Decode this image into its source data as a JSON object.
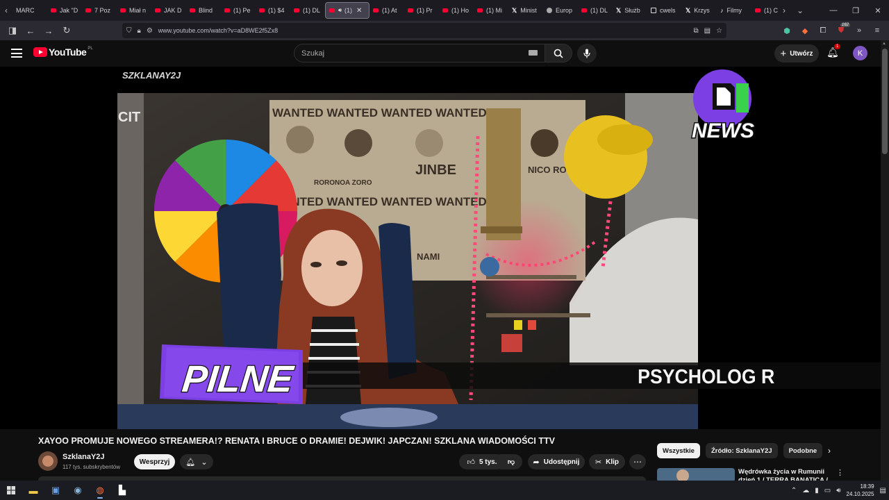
{
  "browser": {
    "tabs": [
      {
        "label": "MARC",
        "icon": "none"
      },
      {
        "label": "Jak \"D",
        "icon": "youtube"
      },
      {
        "label": "7 Poz",
        "icon": "youtube"
      },
      {
        "label": "Miał n",
        "icon": "youtube"
      },
      {
        "label": "JAK D",
        "icon": "youtube"
      },
      {
        "label": "Blind",
        "icon": "youtube"
      },
      {
        "label": "(1) Pe",
        "icon": "youtube"
      },
      {
        "label": "(1) $4",
        "icon": "youtube"
      },
      {
        "label": "(1) DL",
        "icon": "youtube"
      },
      {
        "label": "(1)",
        "icon": "youtube",
        "active": true,
        "audio": true
      },
      {
        "label": "(1) At",
        "icon": "youtube"
      },
      {
        "label": "(1) Pr",
        "icon": "youtube"
      },
      {
        "label": "(1) Ho",
        "icon": "youtube"
      },
      {
        "label": "(1) Mi",
        "icon": "youtube"
      },
      {
        "label": "Minist",
        "icon": "x"
      },
      {
        "label": "Europ",
        "icon": "globe"
      },
      {
        "label": "(1) DL",
        "icon": "youtube"
      },
      {
        "label": "Służb",
        "icon": "x"
      },
      {
        "label": "cwels",
        "icon": "doc"
      },
      {
        "label": "Krzys",
        "icon": "x"
      },
      {
        "label": "Filmy",
        "icon": "tiktok"
      },
      {
        "label": "(1) C",
        "icon": "youtube"
      }
    ],
    "url": "www.youtube.com/watch?v=aD8WE2f5Zx8",
    "extensions_badge": "162"
  },
  "youtube": {
    "logo_text": "YouTube",
    "region": "PL",
    "search_placeholder": "Szukaj",
    "create_label": "Utwórz",
    "notifications_count": "1",
    "avatar_letter": "K"
  },
  "video": {
    "watermark": "SZKLANAY2J",
    "banner": "PILNE",
    "ticker": "PSYCHOLOG R",
    "news_badge": "NEWS",
    "wanted_text": "WANTED WANTED WANTED WANTED",
    "sign_left": "JINBE",
    "sign_right": "NICO ROB",
    "sign_roronoa": "RORONOA ZORO",
    "sign_nami": "NAMI",
    "cit_text": "CIT"
  },
  "info": {
    "title": "XAYOO PROMUJE NOWEGO STREAMERA!? RENATA I BRUCE O DRAMIE! DEJWIK! JAPCZAN! SZKLANA WIADOMOŚCI TTV",
    "channel": "SzklanaY2J",
    "subscribers": "117 tys. subskrybentów",
    "support_label": "Wesprzyj",
    "likes": "5 tys.",
    "share_label": "Udostępnij",
    "clip_label": "Klip"
  },
  "sidebar": {
    "chips": [
      "Wszystkie",
      "Źródło: SzklanaY2J",
      "Podobne"
    ],
    "rec_title": "Wędrówka życia w Rumunii dzień 1 / TERRA BANATICA / ..."
  },
  "taskbar": {
    "time": "18:39",
    "date": "24.10.2025"
  }
}
